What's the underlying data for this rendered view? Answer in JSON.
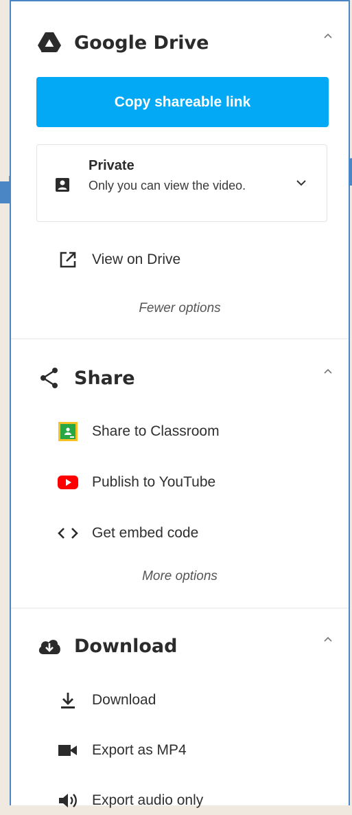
{
  "drive": {
    "title": "Google Drive",
    "copy_link_label": "Copy shareable link",
    "privacy": {
      "title": "Private",
      "description": "Only you can view the video."
    },
    "view_on_drive_label": "View on Drive",
    "fewer_options_label": "Fewer options"
  },
  "share": {
    "title": "Share",
    "items": [
      {
        "label": "Share to Classroom",
        "icon": "classroom-icon"
      },
      {
        "label": "Publish to YouTube",
        "icon": "youtube-icon"
      },
      {
        "label": "Get embed code",
        "icon": "code-icon"
      }
    ],
    "more_options_label": "More options"
  },
  "download": {
    "title": "Download",
    "items": [
      {
        "label": "Download",
        "icon": "download-icon"
      },
      {
        "label": "Export as MP4",
        "icon": "video-camera-icon"
      },
      {
        "label": "Export audio only",
        "icon": "speaker-icon"
      }
    ]
  },
  "colors": {
    "accent": "#03a9f4",
    "youtube": "#ff0000",
    "classroom": "#28a745",
    "annotation_arrow": "#4a86c5"
  }
}
